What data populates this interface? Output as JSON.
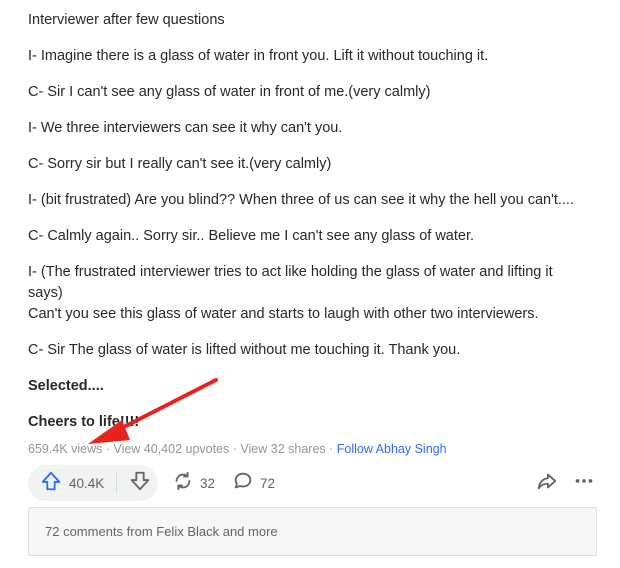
{
  "post": {
    "paragraphs": [
      {
        "lines": [
          "Interviewer after few questions"
        ]
      },
      {
        "lines": [
          "I- Imagine there is a glass of water in front you. Lift it without touching it."
        ]
      },
      {
        "lines": [
          "C- Sir I can't see any glass of water in front of me.(very calmly)"
        ]
      },
      {
        "lines": [
          "I- We three interviewers can see it why can't you."
        ]
      },
      {
        "lines": [
          "C- Sorry sir but I really can't see it.(very calmly)"
        ]
      },
      {
        "lines": [
          "I- (bit frustrated) Are you blind?? When three of us can see it why the hell you can't...."
        ]
      },
      {
        "lines": [
          "C- Calmly again.. Sorry sir.. Believe me I can't see any glass of water."
        ]
      },
      {
        "lines": [
          "I- (The frustrated interviewer tries to act like holding the glass of water and lifting it",
          "says)",
          "Can't you see this glass of water and starts to laugh with other two interviewers."
        ]
      },
      {
        "lines": [
          "C- Sir The glass of water is lifted without me touching it. Thank you."
        ]
      },
      {
        "lines": [
          "Selected...."
        ],
        "bold": true
      },
      {
        "lines": [
          "Cheers to life!!!!"
        ],
        "bold": true
      }
    ]
  },
  "meta": {
    "views": "659.4K views",
    "sep1": " · ",
    "upvotes": "View 40,402 upvotes",
    "sep2": " · ",
    "shares": "View 32 shares",
    "sep3": " · ",
    "follow": "Follow Abhay Singh"
  },
  "actions": {
    "upvote_count": "40.4K",
    "share_count": "32",
    "comment_count": "72"
  },
  "comments_preview": "72 comments from Felix Black and more",
  "colors": {
    "accent": "#2e69ff",
    "annotation_arrow": "#e8231f"
  },
  "icons": [
    "upvote-icon",
    "downvote-icon",
    "reshare-icon",
    "comment-icon",
    "share-icon",
    "more-icon"
  ]
}
